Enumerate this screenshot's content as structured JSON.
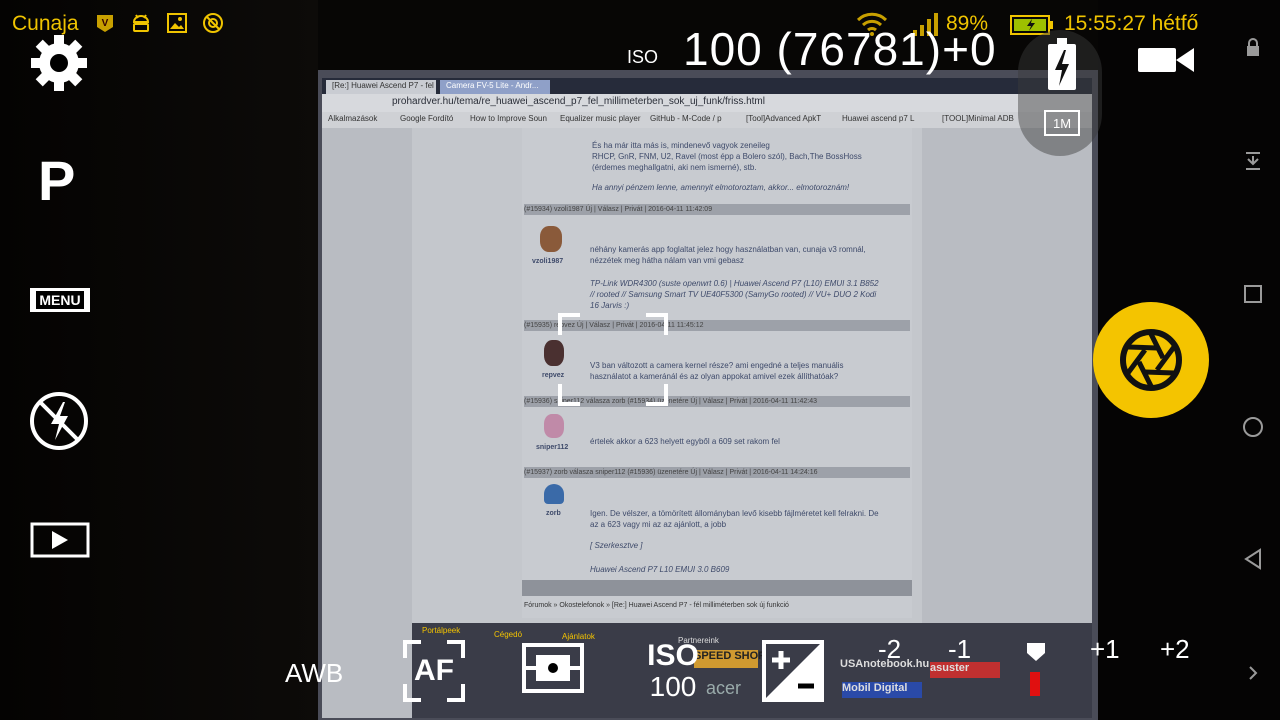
{
  "statusbar": {
    "carrier": "Cunaja",
    "notif_icons": [
      "app-v-icon",
      "android-icon",
      "image-icon",
      "blocked-icon"
    ],
    "battery_percent": "89%",
    "time_day": "15:55:27 hétfő"
  },
  "camera": {
    "mode": "P",
    "menu_label": "MENU",
    "iso_label": "ISO",
    "iso_info": "100  (76781)+0",
    "resolution_badge": "1M",
    "awb_label": "AWB",
    "af_label": "AF",
    "iso_button_label": "ISO",
    "iso_button_value": "100",
    "ev_scale": [
      "-2",
      "-1",
      "+1",
      "+2"
    ],
    "accent_color": "#f4c400",
    "indicator_color": "#e01010"
  },
  "screen_content": {
    "browser_url": "prohardver.hu/tema/re_huawei_ascend_p7_fel_millimeterben_sok_uj_funk/friss.html",
    "tabs": [
      "[Re:] Huawei Ascend P7 - fel millimeterben",
      "Camera FV-5 Lite - Andr..."
    ],
    "bookmarks": [
      "Alkalmazások",
      "Google Fordító",
      "How to Improve Soun",
      "Equalizer music player",
      "GitHub - M-Code / p",
      "[Tool]Advanced ApkT",
      "Huawei ascend p7 L",
      "[TOOL]Minimal ADB"
    ],
    "post1": [
      "És ha már itta más is, mindenevő vagyok zeneileg",
      "RHCP, GnR, FNM, U2, Ravel (most épp a Bolero szól), Bach,The BossHoss",
      "(érdemes meghallgatni, aki nem ismerné), stb.",
      "Ha annyi pénzem lenne, amennyit elmotoroztam, akkor... elmotoroznám!"
    ],
    "post1_header": "(#15934) vzoli1987        Új | Válasz | Privát | 2016-04-11 11:42:09",
    "post2_user": "vzoli1987",
    "post2": [
      "néhány kamerás app foglaltat jelez hogy használatban van, cunaja v3 romnál,",
      "nézzétek meg hátha nálam van vmi gebasz",
      "TP-Link WDR4300 (suste openwrt 0.6) | Huawei Ascend P7 (L10) EMUI 3.1 B852",
      "// rooted // Samsung Smart TV UE40F5300 (SamyGo rooted) // VU+ DUO 2 Kodi",
      "16 Jarvis :)"
    ],
    "post2_header": "(#15935) repvez             Új | Válasz | Privát | 2016-04-11 11:45:12",
    "post3_user": "repvez",
    "post3": [
      "V3 ban változott a camera kernel része? ami engedné a teljes manuális",
      "használatot a kameránál és az olyan appokat amivel ezek állíthatóak?"
    ],
    "post3_header": "(#15936) sniper112 válasza zorb (#15934) üzenetére    Új | Válasz | Privát | 2016-04-11 11:42:43",
    "post4_user": "sniper112",
    "post4": [
      "értelek akkor a 623 helyett egyből a 609 set rakom fel"
    ],
    "post4_header": "(#15937) zorb válasza sniper112 (#15936) üzenetére   Új | Válasz | Privát | 2016-04-11 14:24:16",
    "post5_user": "zorb",
    "post5": [
      "Igen. De vélszer, a tömörített állományban levő kisebb fájlméretet kell felrakni. De",
      "az a 623 vagy mi az az ajánlott, a jobb",
      "[ Szerkesztve ]",
      "Huawei Ascend P7 L10 EMUI 3.0 B609"
    ],
    "footer": "Fórumok » Okostelefonok » [Re:] Huawei Ascend P7 - fél milliméterben sok új funkció",
    "ads": [
      "Portálpeek",
      "Cégedó",
      "Ajánlatok",
      "Partnereink",
      "SPEED SHOP",
      "USAnotebook.hu",
      "asuster",
      "Mobil Digital",
      "acer"
    ]
  }
}
